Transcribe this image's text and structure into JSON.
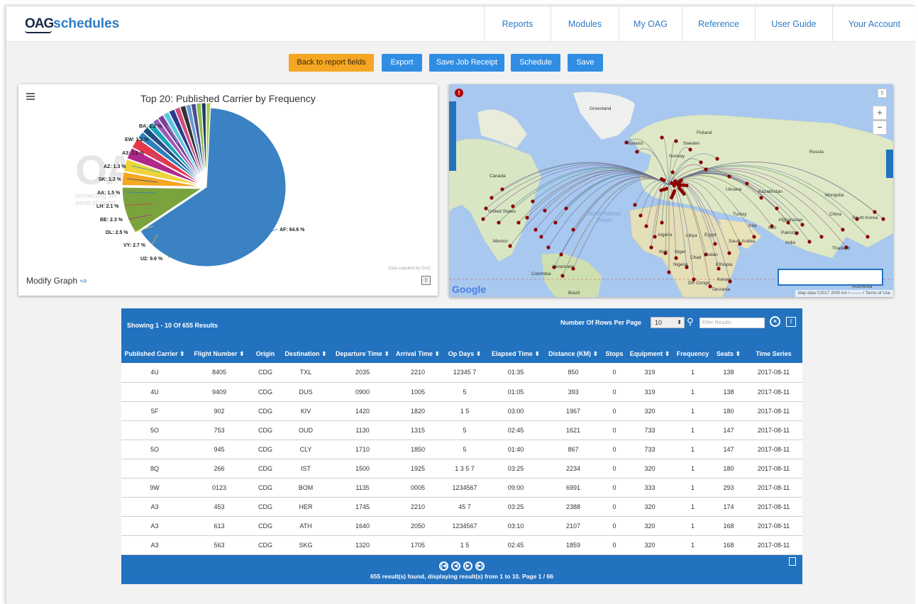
{
  "header": {
    "logo_oag": "OAG",
    "logo_product": "schedules",
    "nav": [
      "Reports",
      "Modules",
      "My OAG",
      "Reference",
      "User Guide",
      "Your Account"
    ]
  },
  "toolbar": {
    "back": "Back to report fields",
    "export": "Export",
    "save_job_receipt": "Save Job Receipt",
    "schedule": "Schedule",
    "save": "Save"
  },
  "chart_panel": {
    "modify_label": "Modify Graph",
    "supplied": "Data supplied by OAG",
    "watermark": "OAG",
    "watermark_tag": "connecting the world of travel"
  },
  "chart_data": {
    "type": "pie",
    "title": "Top 20: Published Carrier by Frequency",
    "slices": [
      {
        "label": "AF",
        "value": 64.6,
        "color": "#3b82c4"
      },
      {
        "label": "U2",
        "value": 9.6,
        "color": "#7aa33d"
      },
      {
        "label": "VY",
        "value": 2.7,
        "color": "#f5a623"
      },
      {
        "label": "DL",
        "value": 2.5,
        "color": "#f0d33a"
      },
      {
        "label": "BE",
        "value": 2.3,
        "color": "#b0298a"
      },
      {
        "label": "LH",
        "value": 2.1,
        "color": "#e2384a"
      },
      {
        "label": "AA",
        "value": 1.5,
        "color": "#2c7fb8"
      },
      {
        "label": "SK",
        "value": 1.3,
        "color": "#1f4f82"
      },
      {
        "label": "AZ",
        "value": 1.3,
        "color": "#17a2b8"
      },
      {
        "label": "A3",
        "value": 1.2,
        "color": "#9b59b6"
      },
      {
        "label": "EW",
        "value": 1.2,
        "color": "#7f3f98"
      },
      {
        "label": "BA",
        "value": 1.2,
        "color": "#5dc8dd"
      },
      {
        "label": "",
        "value": 1.2,
        "color": "#2a3a8c"
      },
      {
        "label": "",
        "value": 1.1,
        "color": "#d14b7b"
      },
      {
        "label": "",
        "value": 1.1,
        "color": "#333333"
      },
      {
        "label": "",
        "value": 1.0,
        "color": "#6a9bd1"
      },
      {
        "label": "",
        "value": 1.0,
        "color": "#4b4b8f"
      },
      {
        "label": "",
        "value": 1.0,
        "color": "#8fbf4e"
      },
      {
        "label": "",
        "value": 0.9,
        "color": "#1c3b6e"
      },
      {
        "label": "",
        "value": 0.9,
        "color": "#aacc55"
      }
    ],
    "data_labels": [
      "AF: 64.6 %",
      "U2: 9.6 %",
      "VY: 2.7 %",
      "DL: 2.5 %",
      "BE: 2.3 %",
      "LH: 2.1 %",
      "AA: 1.5 %",
      "SK: 1.3 %",
      "AZ: 1.3 %",
      "A3: 1.2 %",
      "EW: 1.2 %",
      "BA: 1.2 %"
    ]
  },
  "map": {
    "labels": [
      "Greenland",
      "Iceland",
      "Finland",
      "Sweden",
      "Norway",
      "Russia",
      "Canada",
      "Kazakhstan",
      "Mongolia",
      "United States",
      "Ukraine",
      "China",
      "South Korea",
      "Turkey",
      "Afghanistan",
      "Iran",
      "Pakistan",
      "Iraq",
      "Mexico",
      "Algeria",
      "Libya",
      "Egypt",
      "Saudi Arabia",
      "India",
      "Thailand",
      "Mali",
      "Niger",
      "Chad",
      "Sudan",
      "Nigeria",
      "Ethiopia",
      "Venezuela",
      "Colombia",
      "DR Congo",
      "Kenya",
      "Tanzania",
      "Brazil",
      "Indonesia"
    ],
    "ocean": "North Atlantic Ocean",
    "google": "Google",
    "footer": "Map data ©2017   2000 km ⊢——⊣   Terms of Use",
    "zoom_in": "+",
    "zoom_out": "−"
  },
  "table": {
    "showing": "Showing 1 - 10 Of 655 Results",
    "rows_per_page_label": "Number Of Rows Per Page",
    "rows_per_page_value": "10",
    "filter_placeholder": "Filter Results",
    "columns": [
      "Published Carrier ⬍",
      "Flight Number ⬍",
      "Origin",
      "Destination ⬍",
      "Departure Time ⬍",
      "Arrival Time ⬍",
      "Op Days ⬍",
      "Elapsed Time ⬍",
      "Distance (KM) ⬍",
      "Stops",
      "Equipment ⬍",
      "Frequency",
      "Seats ⬍",
      "Time Series"
    ],
    "rows": [
      [
        "4U",
        "8405",
        "CDG",
        "TXL",
        "2035",
        "2210",
        "12345 7",
        "01:35",
        "850",
        "0",
        "319",
        "1",
        "138",
        "2017-08-11"
      ],
      [
        "4U",
        "9409",
        "CDG",
        "DUS",
        "0900",
        "1005",
        "5",
        "01:05",
        "393",
        "0",
        "319",
        "1",
        "138",
        "2017-08-11"
      ],
      [
        "5F",
        "902",
        "CDG",
        "KIV",
        "1420",
        "1820",
        "1 5",
        "03:00",
        "1967",
        "0",
        "320",
        "1",
        "180",
        "2017-08-11"
      ],
      [
        "5O",
        "753",
        "CDG",
        "OUD",
        "1130",
        "1315",
        "5",
        "02:45",
        "1621",
        "0",
        "733",
        "1",
        "147",
        "2017-08-11"
      ],
      [
        "5O",
        "945",
        "CDG",
        "CLY",
        "1710",
        "1850",
        "5",
        "01:40",
        "867",
        "0",
        "733",
        "1",
        "147",
        "2017-08-11"
      ],
      [
        "8Q",
        "266",
        "CDG",
        "IST",
        "1500",
        "1925",
        "1 3 5 7",
        "03:25",
        "2234",
        "0",
        "320",
        "1",
        "180",
        "2017-08-11"
      ],
      [
        "9W",
        "0123",
        "CDG",
        "BOM",
        "1135",
        "0005",
        "1234567",
        "09:00",
        "6991",
        "0",
        "333",
        "1",
        "293",
        "2017-08-11"
      ],
      [
        "A3",
        "453",
        "CDG",
        "HER",
        "1745",
        "2210",
        "45 7",
        "03:25",
        "2388",
        "0",
        "320",
        "1",
        "174",
        "2017-08-11"
      ],
      [
        "A3",
        "613",
        "CDG",
        "ATH",
        "1640",
        "2050",
        "1234567",
        "03:10",
        "2107",
        "0",
        "320",
        "1",
        "168",
        "2017-08-11"
      ],
      [
        "A3",
        "563",
        "CDG",
        "SKG",
        "1320",
        "1705",
        "1 5",
        "02:45",
        "1859",
        "0",
        "320",
        "1",
        "168",
        "2017-08-11"
      ]
    ],
    "summary": "655 result(s) found, displaying result(s) from 1 to 10. Page 1 / 66"
  }
}
